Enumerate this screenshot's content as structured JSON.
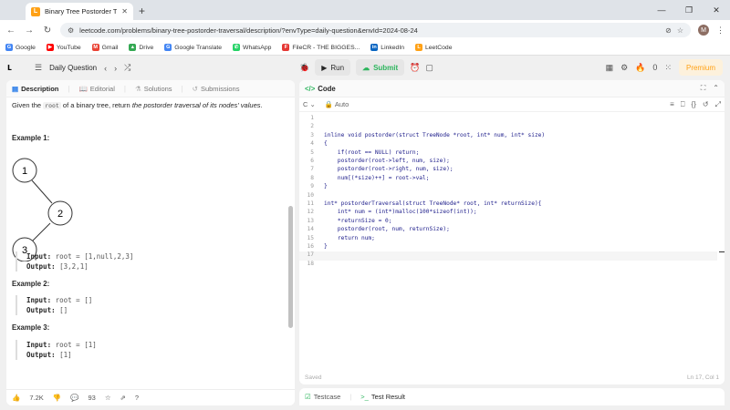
{
  "browser": {
    "tab_title": "Binary Tree Postorder Traversal",
    "tab_favicon": "L",
    "url": "leetcode.com/problems/binary-tree-postorder-traversal/description/?envType=daily-question&envId=2024-08-24",
    "avatar_letter": "M",
    "bookmarks": [
      {
        "label": "Google",
        "color": "#4285f4",
        "glyph": "G"
      },
      {
        "label": "YouTube",
        "color": "#ff0000",
        "glyph": "▶"
      },
      {
        "label": "Gmail",
        "color": "#ea4335",
        "glyph": "M"
      },
      {
        "label": "Drive",
        "color": "#34a853",
        "glyph": "▲"
      },
      {
        "label": "Google Translate",
        "color": "#4285f4",
        "glyph": "G"
      },
      {
        "label": "WhatsApp",
        "color": "#25d366",
        "glyph": "✆"
      },
      {
        "label": "FileCR - THE BIGGES...",
        "color": "#e53935",
        "glyph": "F"
      },
      {
        "label": "LinkedIn",
        "color": "#0a66c2",
        "glyph": "in"
      },
      {
        "label": "LeetCode",
        "color": "#ffa116",
        "glyph": "L"
      }
    ]
  },
  "toolbar": {
    "daily_question": "Daily Question",
    "run_label": "Run",
    "submit_label": "Submit",
    "streak_count": "0",
    "premium_label": "Premium"
  },
  "left_panel": {
    "tabs": [
      {
        "label": "Description",
        "icon": "document-icon"
      },
      {
        "label": "Editorial",
        "icon": "book-icon"
      },
      {
        "label": "Solutions",
        "icon": "flask-icon"
      },
      {
        "label": "Submissions",
        "icon": "history-icon"
      }
    ],
    "desc_pre": "Given the ",
    "desc_code": "root",
    "desc_mid": " of a binary tree, return ",
    "desc_em": "the postorder traversal of its nodes' values",
    "desc_end": ".",
    "examples": [
      {
        "title": "Example 1:",
        "input_label": "Input:",
        "input": "root = [1,null,2,3]",
        "output_label": "Output:",
        "output": "[3,2,1]"
      },
      {
        "title": "Example 2:",
        "input_label": "Input:",
        "input": "root = []",
        "output_label": "Output:",
        "output": "[]"
      },
      {
        "title": "Example 3:",
        "input_label": "Input:",
        "input": "root = [1]",
        "output_label": "Output:",
        "output": "[1]"
      }
    ],
    "tree_nodes": [
      "1",
      "2",
      "3"
    ],
    "likes": "7.2K",
    "comments": "93"
  },
  "code_panel": {
    "title": "Code",
    "language": "C",
    "mode": "Auto",
    "status": "Saved",
    "cursor_pos": "Ln 17, Col 1",
    "lines": [
      "",
      "",
      "inline void postorder(struct TreeNode *root, int* num, int* size)",
      "{",
      "    if(root == NULL) return;",
      "    postorder(root->left, num, size);",
      "    postorder(root->right, num, size);",
      "    num[(*size)++] = root->val;",
      "}",
      "",
      "int* postorderTraversal(struct TreeNode* root, int* returnSize){",
      "    int* num = (int*)malloc(100*sizeof(int));",
      "    *returnSize = 0;",
      "    postorder(root, num, returnSize);",
      "    return num;",
      "}",
      "",
      ""
    ]
  },
  "bottom_panel": {
    "testcase_label": "Testcase",
    "result_label": "Test Result"
  }
}
